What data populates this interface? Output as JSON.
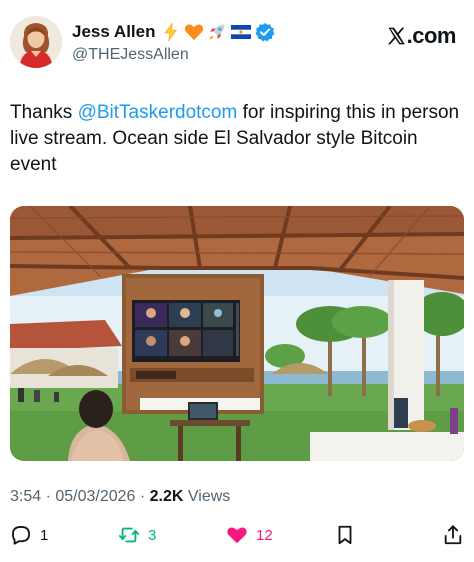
{
  "author": {
    "display_name": "Jess Allen",
    "handle": "@THEJessAllen",
    "emoji_icons": [
      "lightning-icon",
      "orange-heart-icon",
      "rocket-icon",
      "el-salvador-flag-icon"
    ],
    "verified": true
  },
  "brand": {
    "logo_text": ".com"
  },
  "tweet": {
    "prefix": "Thanks ",
    "mention": "@BitTaskerdotcom",
    "suffix": " for inspiring this in person live stream. Ocean side El Salvador style Bitcoin event"
  },
  "media": {
    "description_icon": "photo-outdoor-livestream"
  },
  "meta": {
    "time": "3:54",
    "separator": " · ",
    "date": "05/03/2026",
    "views_count": "2.2K",
    "views_label": " Views"
  },
  "actions": {
    "reply_count": "1",
    "retweet_count": "3",
    "like_count": "12"
  },
  "colors": {
    "link": "#1d9bf0",
    "retweet": "#00ba7c",
    "like": "#f91880",
    "secondary_text": "#536471",
    "verified": "#1d9bf0"
  }
}
